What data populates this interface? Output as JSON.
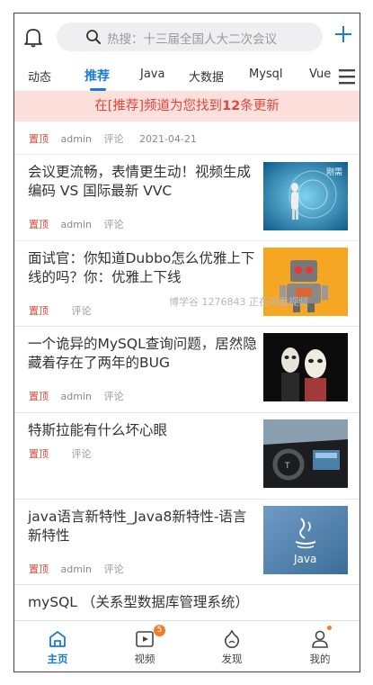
{
  "header": {
    "search_placeholder": "热搜：十三届全国人大二次会议"
  },
  "tabs": [
    {
      "label": "动态"
    },
    {
      "label": "推荐"
    },
    {
      "label": "Java"
    },
    {
      "label": "大数据"
    },
    {
      "label": "Mysql"
    },
    {
      "label": "Vue"
    }
  ],
  "banner": {
    "prefix": "在[推荐]频道为您找到",
    "count": "12",
    "suffix": "条更新"
  },
  "pinned_meta": {
    "tag": "置顶",
    "author": "admin",
    "comment": "评论",
    "date": "2021-04-21"
  },
  "articles": [
    {
      "title": "会议更流畅，表情更生动！视频生成编码 VS 国际最新 VVC",
      "tag": "置顶",
      "author": "admin",
      "comment": "评论",
      "thumb": "video-codec-image"
    },
    {
      "title": "面试官：你知道Dubbo怎么优雅上下线的吗？你：优雅上下线",
      "tag": "置顶",
      "author": "",
      "comment": "评论",
      "thumb": "robot-image"
    },
    {
      "title": "一个诡异的MySQL查询问题，居然隐藏着存在了两年的BUG",
      "tag": "置顶",
      "author": "admin",
      "comment": "评论",
      "thumb": "masks-image"
    },
    {
      "title": "特斯拉能有什么坏心眼",
      "tag": "置顶",
      "author": "",
      "comment": "评论",
      "thumb": "tesla-dashboard-image"
    },
    {
      "title": "java语言新特性_Java8新特性-语言新特性",
      "tag": "置顶",
      "author": "admin",
      "comment": "评论",
      "thumb": "java-logo-image"
    },
    {
      "title": "mySQL （关系型数据库管理系统）"
    }
  ],
  "watermark": "博学谷 1276843 正在观看视频",
  "bottom_nav": [
    {
      "label": "主页",
      "icon": "home-icon"
    },
    {
      "label": "视频",
      "icon": "video-icon",
      "badge": "5"
    },
    {
      "label": "发现",
      "icon": "discover-icon"
    },
    {
      "label": "我的",
      "icon": "profile-icon"
    }
  ],
  "colors": {
    "accent": "#1a7bd6",
    "banner_bg": "#fde0dc",
    "banner_text": "#e2453c",
    "pin": "#e0453a",
    "badge": "#f07b2a"
  }
}
